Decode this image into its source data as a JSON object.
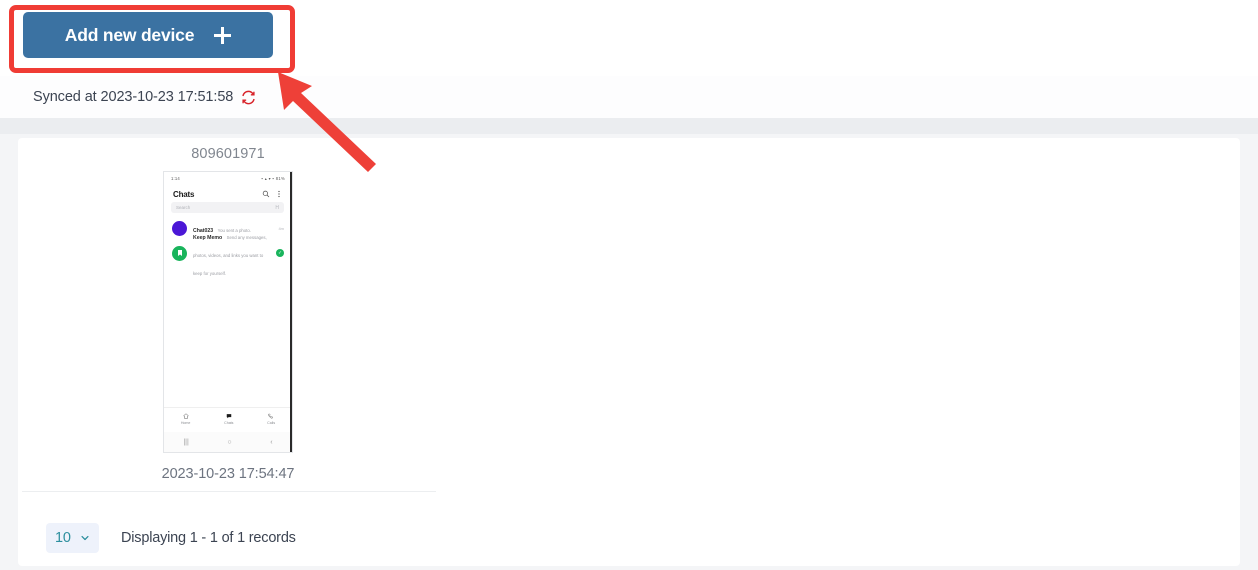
{
  "toolbar": {
    "add_device_label": "Add new device",
    "add_device_icon": "plus-icon"
  },
  "sync": {
    "text": "Synced at 2023-10-23 17:51:58",
    "refresh_icon": "refresh-icon"
  },
  "devices": [
    {
      "id": "809601971",
      "timestamp": "2023-10-23 17:54:47",
      "preview": {
        "status_time": "1:14",
        "status_icons": "▪ ▴ ▾ ▪ 81%",
        "app_title": "Chats",
        "header_icons": [
          "search-icon",
          "overflow-menu-icon"
        ],
        "search_placeholder": "Search",
        "search_action": "H",
        "chats": [
          {
            "name": "Chat023",
            "subtitle": "You sent a photo.",
            "meta": "4m",
            "avatar_color": "#4b17d6",
            "badge": ""
          },
          {
            "name": "Keep Memo",
            "subtitle": "Send any messages, photos, videos, and links you want to keep for yourself.",
            "meta": "",
            "avatar_color": "#19b45c",
            "badge": "✓"
          }
        ],
        "bottom_nav": [
          {
            "icon": "home-icon",
            "label": "Home"
          },
          {
            "icon": "chats-icon",
            "label": "Chats"
          },
          {
            "icon": "calls-icon",
            "label": "Calls"
          }
        ],
        "system_nav": [
          "recents-icon",
          "home-circle-icon",
          "back-icon"
        ]
      }
    }
  ],
  "footer": {
    "page_size_value": "10",
    "page_size_chevron": "chevron-down-icon",
    "records_text": "Displaying 1 - 1 of 1 records"
  },
  "annotations": {
    "highlight_target": "add-device-button",
    "highlight_color": "#f03c35",
    "arrow_color": "#ee4038"
  },
  "colors": {
    "primary_button": "#3b72a2",
    "page_background": "#f4f5f7",
    "card_background": "#ffffff",
    "accent_teal": "#2d8f9e",
    "refresh_red": "#d8232a"
  }
}
